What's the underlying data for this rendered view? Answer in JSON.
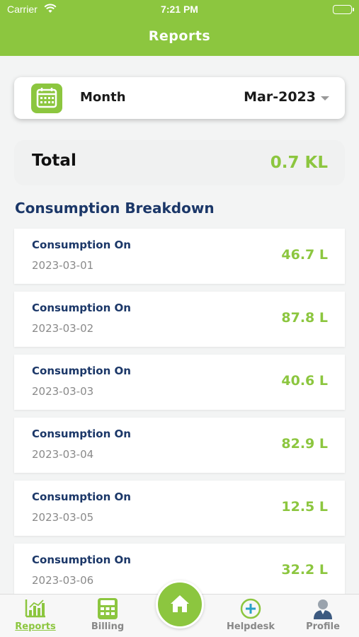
{
  "status_bar": {
    "carrier": "Carrier",
    "time": "7:21 PM"
  },
  "header": {
    "title": "Reports"
  },
  "month_selector": {
    "label": "Month",
    "value": "Mar-2023"
  },
  "total": {
    "label": "Total",
    "value": "0.7 KL"
  },
  "breakdown": {
    "title": "Consumption Breakdown",
    "items": [
      {
        "label": "Consumption On",
        "date": "2023-03-01",
        "value": "46.7 L"
      },
      {
        "label": "Consumption On",
        "date": "2023-03-02",
        "value": "87.8 L"
      },
      {
        "label": "Consumption On",
        "date": "2023-03-03",
        "value": "40.6 L"
      },
      {
        "label": "Consumption On",
        "date": "2023-03-04",
        "value": "82.9 L"
      },
      {
        "label": "Consumption On",
        "date": "2023-03-05",
        "value": "12.5 L"
      },
      {
        "label": "Consumption On",
        "date": "2023-03-06",
        "value": "32.2 L"
      }
    ]
  },
  "tab_bar": {
    "tabs": [
      {
        "label": "Reports",
        "icon": "bar-chart-icon"
      },
      {
        "label": "Billing",
        "icon": "calculator-icon"
      },
      {
        "label": "",
        "icon": "home-icon"
      },
      {
        "label": "Helpdesk",
        "icon": "plus-circle-icon"
      },
      {
        "label": "Profile",
        "icon": "user-icon"
      }
    ]
  },
  "colors": {
    "accent": "#8cc63f",
    "title_navy": "#1b3768"
  }
}
